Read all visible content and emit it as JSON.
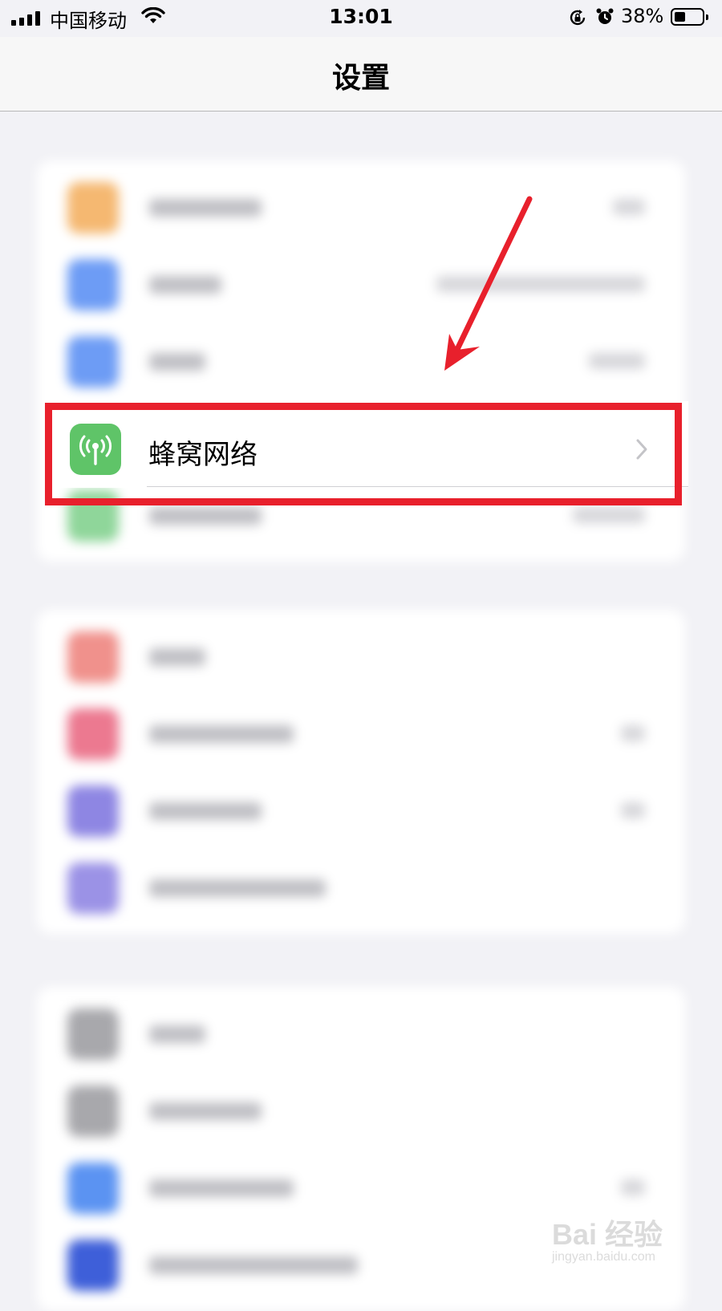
{
  "status_bar": {
    "carrier": "中国移动",
    "time": "13:01",
    "battery_percent": "38%",
    "battery_level": 0.38,
    "icons": [
      "signal-icon",
      "wifi-icon",
      "orientation-lock-icon",
      "alarm-icon",
      "battery-icon"
    ]
  },
  "nav": {
    "title": "设置"
  },
  "highlighted_item": {
    "label": "蜂窝网络",
    "icon": "antenna-icon",
    "icon_color": "#5fc468"
  },
  "annotation": {
    "box_color": "#e8202c",
    "arrow_color": "#e8202c"
  },
  "blurred_groups": [
    {
      "rows": [
        {
          "icon_color": "#f5b871"
        },
        {
          "icon_color": "#6d9cf5"
        },
        {
          "icon_color": "#6d9cf5"
        },
        {
          "icon_color": "#5fc468"
        },
        {
          "icon_color": "#8fd69a"
        }
      ]
    },
    {
      "rows": [
        {
          "icon_color": "#f0918c"
        },
        {
          "icon_color": "#ec7990"
        },
        {
          "icon_color": "#8e86e3"
        },
        {
          "icon_color": "#9b92e6"
        }
      ]
    },
    {
      "rows": [
        {
          "icon_color": "#a8a8ac"
        },
        {
          "icon_color": "#a8a8ac"
        },
        {
          "icon_color": "#5b93f2"
        },
        {
          "icon_color": "#3e5fd9"
        }
      ]
    }
  ],
  "watermark": {
    "brand": "Bai 经验",
    "url": "jingyan.baidu.com"
  }
}
